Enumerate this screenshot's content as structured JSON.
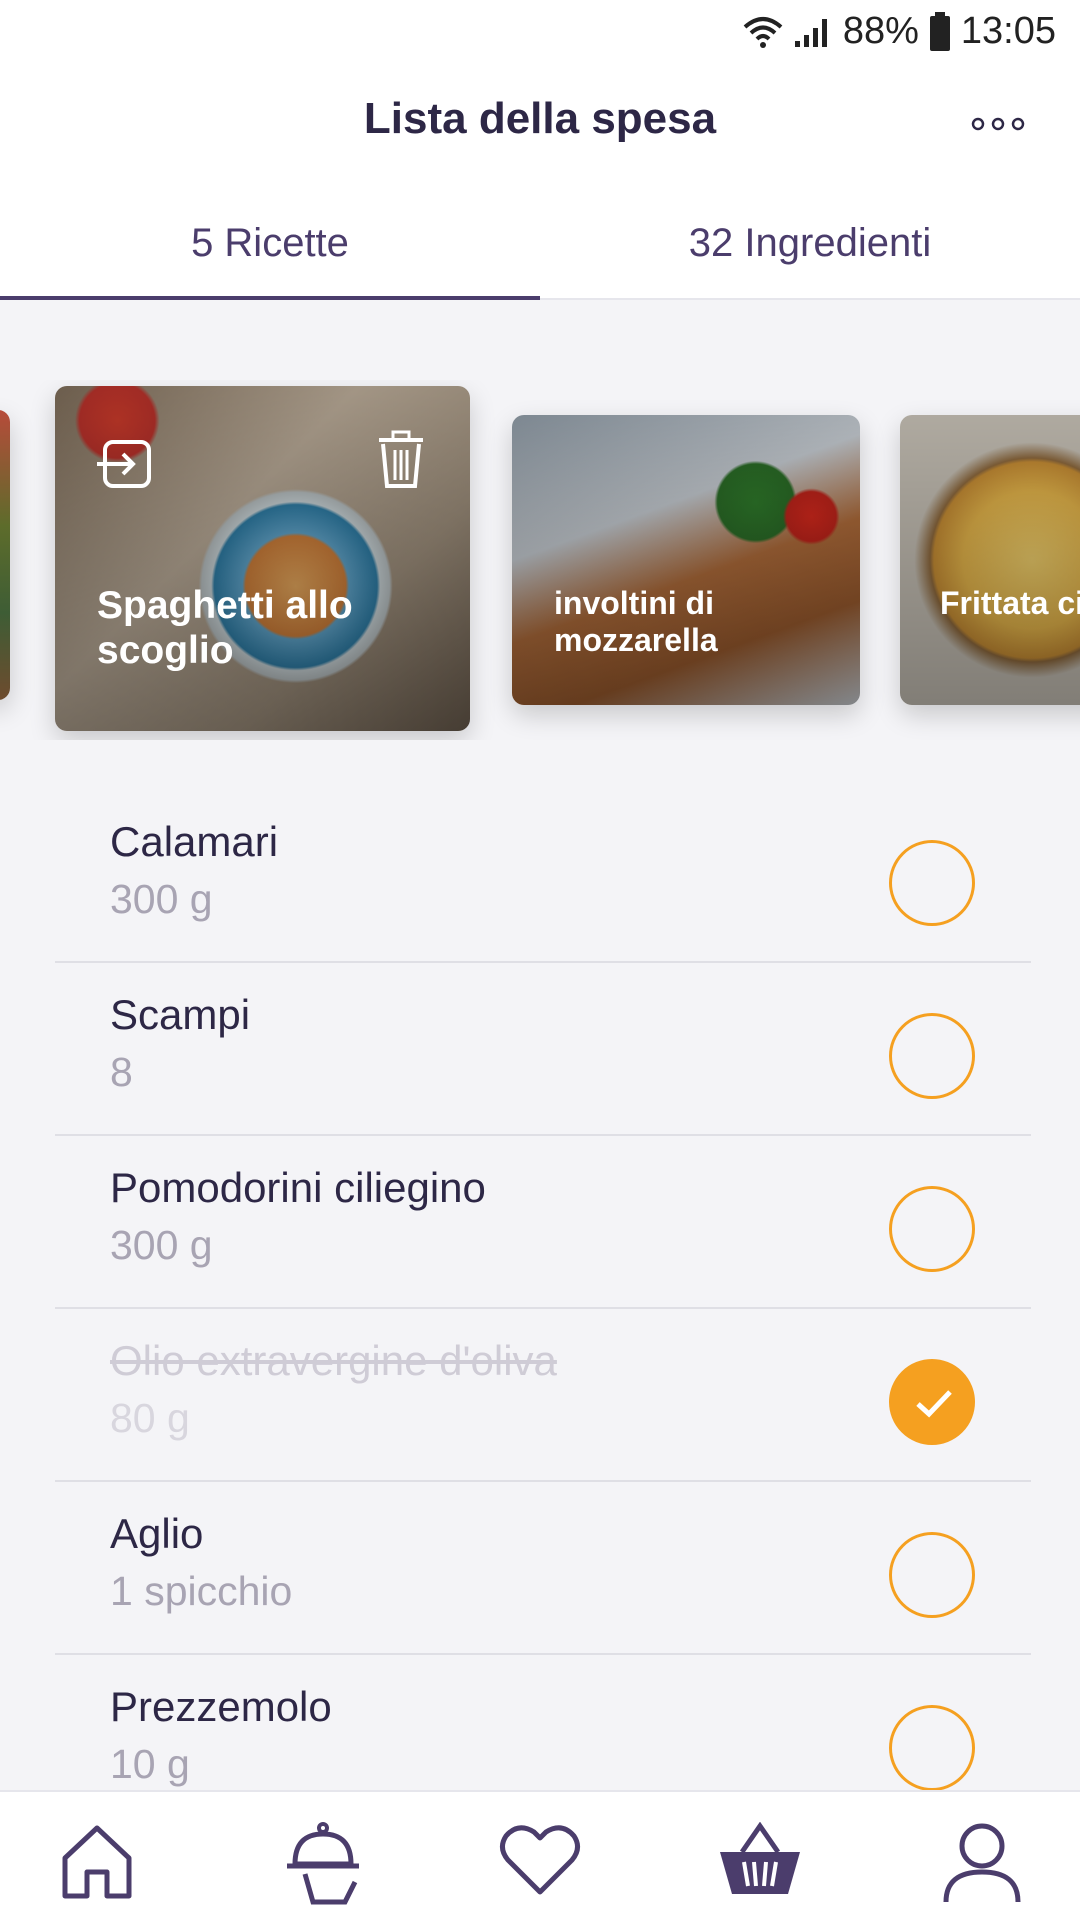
{
  "status_bar": {
    "battery": "88%",
    "time": "13:05"
  },
  "header": {
    "title": "Lista della spesa",
    "more_icon": "more-horizontal-icon"
  },
  "tabs": [
    {
      "label": "5 Ricette",
      "selected": true
    },
    {
      "label": "32 Ingredienti",
      "selected": false
    }
  ],
  "recipes": [
    {
      "title": "Spaghetti allo scoglio"
    },
    {
      "title": "involtini di mozzarella"
    },
    {
      "title": "Frittata cipolle"
    }
  ],
  "ingredients": [
    {
      "name": "Calamari",
      "qty": "300 g",
      "checked": false
    },
    {
      "name": "Scampi",
      "qty": "8",
      "checked": false
    },
    {
      "name": "Pomodorini ciliegino",
      "qty": "300 g",
      "checked": false
    },
    {
      "name": "Olio extravergine d'oliva",
      "qty": "80 g",
      "checked": true
    },
    {
      "name": "Aglio",
      "qty": "1 spicchio",
      "checked": false
    },
    {
      "name": "Prezzemolo",
      "qty": "10 g",
      "checked": false
    }
  ],
  "bottom_nav": [
    {
      "icon": "home-icon",
      "active": false
    },
    {
      "icon": "chef-serving-icon",
      "active": false
    },
    {
      "icon": "heart-icon",
      "active": false
    },
    {
      "icon": "basket-icon",
      "active": true
    },
    {
      "icon": "user-icon",
      "active": false
    }
  ],
  "colors": {
    "primary": "#4b3d6c",
    "accent": "#f5a020",
    "background": "#f4f4f7"
  }
}
